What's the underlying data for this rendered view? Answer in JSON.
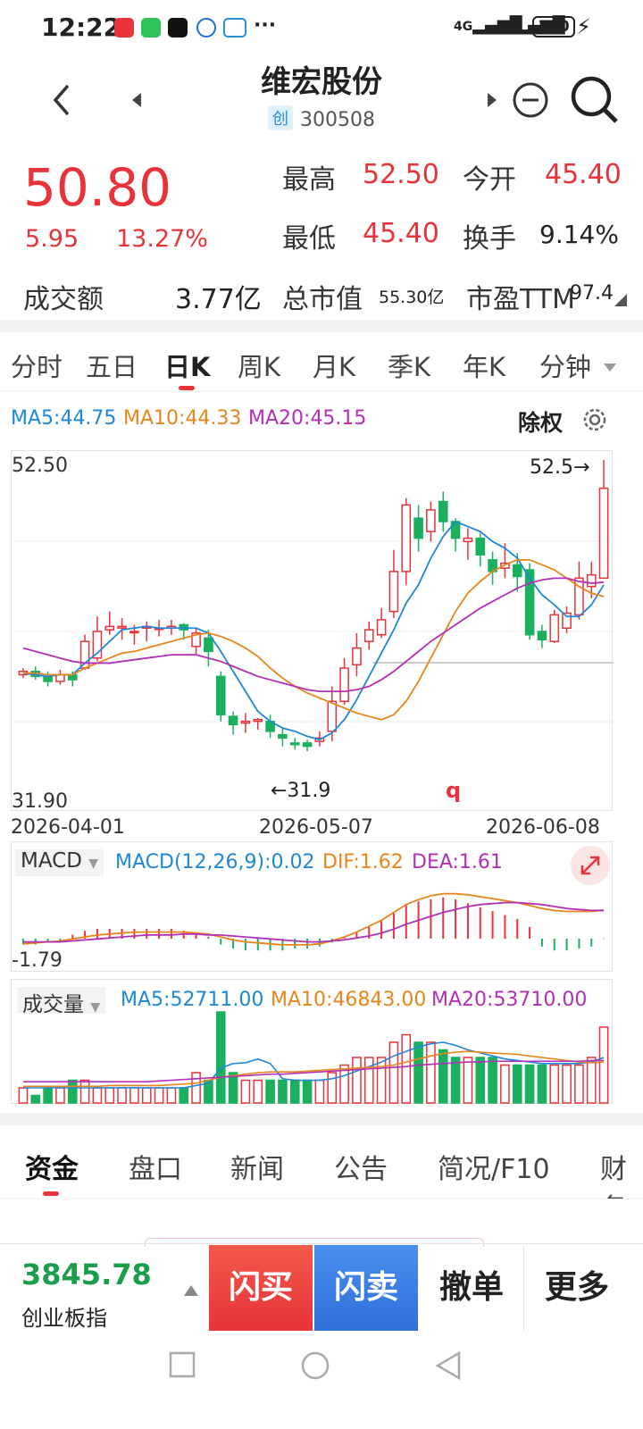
{
  "status_bar": {
    "time": "12:22",
    "network1": "4G",
    "network2": "4G",
    "battery": "100"
  },
  "header": {
    "title": "维宏股份",
    "board_badge": "创",
    "code": "300508"
  },
  "quote": {
    "price": "50.80",
    "change": "5.95",
    "change_pct": "13.27%",
    "high_label": "最高",
    "high": "52.50",
    "open_label": "今开",
    "open": "45.40",
    "low_label": "最低",
    "low": "45.40",
    "turnover_label": "换手",
    "turnover": "9.14%",
    "amount_label": "成交额",
    "amount": "3.77亿",
    "mktcap_label": "总市值",
    "mktcap": "55.30亿",
    "pe_label": "市盈TTM",
    "pe": "97.4"
  },
  "period_tabs": [
    {
      "label": "分时"
    },
    {
      "label": "五日"
    },
    {
      "label": "日K"
    },
    {
      "label": "周K"
    },
    {
      "label": "月K"
    },
    {
      "label": "季K"
    },
    {
      "label": "年K"
    },
    {
      "label": "分钟"
    }
  ],
  "active_period": "日K",
  "ma_legend": {
    "ma5": "MA5:44.75",
    "ma10": "MA10:44.33",
    "ma20": "MA20:45.15"
  },
  "adjust_label": "除权",
  "kline": {
    "y_max_label": "52.50",
    "y_min_label": "31.90",
    "high_marker": "52.5→",
    "low_marker": "←31.9",
    "stray_mark": "q",
    "dates": [
      "2026-04-01",
      "2026-05-07",
      "2026-06-08"
    ]
  },
  "macd": {
    "name": "MACD",
    "params": "MACD(12,26,9):0.02",
    "dif": "DIF:1.62",
    "dea": "DEA:1.61",
    "axis_label": "-1.79"
  },
  "volume": {
    "name": "成交量",
    "ma5": "MA5:52711.00",
    "ma10": "MA10:46843.00",
    "ma20": "MA20:53710.00"
  },
  "bottom_tabs": [
    {
      "label": "资金"
    },
    {
      "label": "盘口"
    },
    {
      "label": "新闻"
    },
    {
      "label": "公告"
    },
    {
      "label": "简况/F10"
    },
    {
      "label": "财务"
    }
  ],
  "index": {
    "value": "3845.78",
    "name": "创业板指"
  },
  "trade_buttons": {
    "flash_buy": "闪买",
    "flash_sell": "闪卖",
    "cancel": "撤单",
    "more": "更多"
  },
  "colors": {
    "up": "#e8333a",
    "down": "#1bb05e",
    "ma5": "#1e88d8",
    "ma10": "#e8851c",
    "ma20": "#b32fb6"
  },
  "chart_data": {
    "type": "candlestick",
    "title": "",
    "x_range": [
      "2026-04-01",
      "2026-06-08"
    ],
    "ylim": [
      31.9,
      52.5
    ],
    "candles": [
      [
        39.6,
        39.8,
        39.4,
        40.0
      ],
      [
        39.8,
        39.5,
        39.3,
        40.1
      ],
      [
        39.5,
        39.2,
        38.9,
        39.8
      ],
      [
        39.2,
        39.6,
        39.0,
        39.9
      ],
      [
        39.6,
        39.3,
        38.9,
        39.8
      ],
      [
        40.0,
        41.6,
        39.9,
        42.0
      ],
      [
        40.6,
        42.2,
        40.4,
        43.1
      ],
      [
        42.3,
        42.5,
        42.0,
        43.4
      ],
      [
        42.4,
        42.5,
        41.7,
        43.0
      ],
      [
        42.2,
        42.2,
        41.4,
        42.6
      ],
      [
        42.4,
        42.5,
        41.6,
        42.8
      ],
      [
        42.4,
        42.4,
        41.9,
        42.9
      ],
      [
        42.4,
        42.5,
        42.0,
        42.9
      ],
      [
        42.6,
        42.3,
        41.7,
        42.7
      ],
      [
        41.3,
        42.1,
        40.8,
        42.4
      ],
      [
        41.8,
        41.0,
        40.1,
        42.3
      ],
      [
        39.5,
        37.2,
        36.8,
        39.8
      ],
      [
        37.1,
        36.6,
        36.0,
        37.4
      ],
      [
        36.7,
        36.8,
        36.1,
        37.3
      ],
      [
        36.8,
        36.9,
        36.3,
        37.0
      ],
      [
        36.8,
        36.2,
        35.8,
        37.2
      ],
      [
        36.0,
        35.8,
        35.3,
        36.4
      ],
      [
        35.5,
        35.4,
        35.1,
        35.8
      ],
      [
        35.5,
        35.3,
        35.0,
        35.7
      ],
      [
        35.6,
        35.8,
        35.3,
        36.2
      ],
      [
        36.2,
        38.0,
        35.6,
        38.9
      ],
      [
        38.0,
        40.0,
        37.8,
        40.6
      ],
      [
        40.2,
        41.2,
        39.5,
        42.1
      ],
      [
        41.6,
        42.3,
        41.1,
        42.8
      ],
      [
        42.0,
        42.9,
        41.8,
        43.6
      ],
      [
        43.4,
        45.8,
        43.0,
        47.1
      ],
      [
        45.8,
        49.8,
        45.0,
        50.2
      ],
      [
        49.0,
        47.8,
        47.0,
        49.8
      ],
      [
        48.2,
        49.5,
        47.6,
        50.0
      ],
      [
        50.0,
        48.8,
        48.2,
        50.6
      ],
      [
        48.8,
        47.8,
        47.0,
        49.0
      ],
      [
        47.6,
        47.8,
        46.5,
        48.4
      ],
      [
        47.8,
        46.8,
        46.1,
        48.1
      ],
      [
        46.5,
        45.8,
        45.0,
        47.0
      ],
      [
        46.0,
        46.3,
        45.4,
        47.5
      ],
      [
        46.2,
        45.5,
        44.6,
        46.9
      ],
      [
        45.9,
        42.0,
        41.7,
        46.3
      ],
      [
        42.2,
        41.7,
        41.2,
        42.6
      ],
      [
        41.6,
        43.2,
        41.5,
        43.5
      ],
      [
        42.4,
        43.3,
        42.1,
        43.7
      ],
      [
        43.2,
        45.4,
        42.9,
        46.4
      ],
      [
        44.9,
        45.6,
        44.2,
        46.4
      ],
      [
        45.4,
        50.8,
        45.4,
        52.5
      ]
    ],
    "ma5": [
      39.7,
      39.6,
      39.5,
      39.6,
      39.6,
      40.3,
      40.9,
      41.6,
      42.3,
      42.4,
      42.5,
      42.4,
      42.4,
      42.4,
      42.4,
      42.1,
      41.0,
      39.8,
      38.6,
      37.4,
      36.8,
      36.4,
      36.2,
      35.9,
      35.7,
      36.1,
      36.9,
      38.1,
      39.5,
      40.9,
      42.3,
      43.9,
      45.0,
      46.6,
      47.9,
      48.8,
      48.5,
      48.2,
      47.6,
      47.2,
      46.6,
      45.4,
      44.4,
      43.8,
      43.1,
      43.1,
      43.8,
      45.0
    ],
    "ma10": [
      39.7,
      39.7,
      39.6,
      39.6,
      39.6,
      40.0,
      40.3,
      40.6,
      40.9,
      41.0,
      41.2,
      41.4,
      41.6,
      41.8,
      42.0,
      42.1,
      41.9,
      41.6,
      41.2,
      40.7,
      40.0,
      39.4,
      38.9,
      38.5,
      38.2,
      37.9,
      37.6,
      37.3,
      37.1,
      36.9,
      37.2,
      38.0,
      39.2,
      40.6,
      42.0,
      43.4,
      44.5,
      45.2,
      45.8,
      46.2,
      46.5,
      46.5,
      46.2,
      45.9,
      45.4,
      44.9,
      44.5,
      44.3
    ],
    "ma20": [
      41.2,
      41.0,
      40.8,
      40.6,
      40.4,
      40.3,
      40.3,
      40.3,
      40.4,
      40.5,
      40.6,
      40.7,
      40.8,
      40.8,
      40.8,
      40.6,
      40.4,
      40.1,
      39.8,
      39.5,
      39.3,
      39.1,
      38.9,
      38.7,
      38.6,
      38.6,
      38.6,
      38.7,
      38.9,
      39.3,
      39.8,
      40.4,
      41.0,
      41.6,
      42.1,
      42.6,
      43.1,
      43.6,
      44.0,
      44.4,
      44.8,
      45.1,
      45.3,
      45.4,
      45.4,
      45.2,
      45.1,
      45.15
    ],
    "macd_hist": [
      -0.3,
      -0.3,
      -0.2,
      -0.1,
      0.2,
      0.4,
      0.5,
      0.5,
      0.5,
      0.5,
      0.5,
      0.5,
      0.5,
      0.4,
      0.3,
      0.1,
      -0.3,
      -0.5,
      -0.6,
      -0.6,
      -0.6,
      -0.6,
      -0.5,
      -0.5,
      -0.4,
      -0.2,
      0.1,
      0.3,
      0.6,
      0.9,
      1.3,
      1.7,
      1.9,
      2.0,
      2.1,
      2.0,
      1.8,
      1.6,
      1.4,
      1.2,
      1.0,
      0.6,
      -0.4,
      -0.6,
      -0.6,
      -0.5,
      -0.4,
      0.02
    ],
    "dif": [
      -1.8,
      -1.7,
      -1.6,
      -1.5,
      -1.3,
      -1.1,
      -0.9,
      -0.8,
      -0.7,
      -0.6,
      -0.6,
      -0.6,
      -0.6,
      -0.6,
      -0.7,
      -0.8,
      -1.1,
      -1.4,
      -1.6,
      -1.7,
      -1.8,
      -1.9,
      -1.9,
      -1.9,
      -1.8,
      -1.5,
      -1.1,
      -0.6,
      0.0,
      0.6,
      1.4,
      2.2,
      2.7,
      3.1,
      3.3,
      3.3,
      3.2,
      3.0,
      2.8,
      2.6,
      2.4,
      2.1,
      1.8,
      1.6,
      1.5,
      1.5,
      1.5,
      1.62
    ],
    "dea": [
      -1.6,
      -1.6,
      -1.6,
      -1.6,
      -1.5,
      -1.4,
      -1.3,
      -1.2,
      -1.1,
      -1.0,
      -0.9,
      -0.9,
      -0.9,
      -0.8,
      -0.8,
      -0.9,
      -0.9,
      -1.0,
      -1.1,
      -1.2,
      -1.3,
      -1.4,
      -1.5,
      -1.6,
      -1.6,
      -1.5,
      -1.4,
      -1.2,
      -1.0,
      -0.7,
      -0.3,
      0.2,
      0.6,
      1.0,
      1.4,
      1.7,
      2.0,
      2.2,
      2.3,
      2.4,
      2.4,
      2.3,
      2.2,
      2.0,
      1.8,
      1.7,
      1.6,
      1.61
    ],
    "volume": [
      2,
      1,
      2,
      2,
      3,
      3,
      2,
      2,
      2,
      2,
      2,
      2,
      2,
      2,
      4,
      3,
      12,
      4,
      3,
      3,
      3,
      3,
      3,
      3,
      3,
      4,
      5,
      6,
      6,
      6,
      8,
      9,
      8,
      8,
      7,
      6,
      6,
      6,
      6,
      5,
      5,
      5,
      5,
      5,
      5,
      5,
      6,
      10
    ],
    "vol_ma5": [
      2,
      2,
      2,
      2,
      2,
      2,
      2,
      2,
      2,
      2,
      2,
      2,
      2,
      2,
      2.3,
      2.6,
      4.6,
      5.2,
      5.3,
      5.8,
      5.2,
      3.2,
      3.0,
      3.0,
      3.0,
      3.2,
      3.6,
      4.2,
      4.8,
      5.4,
      6.2,
      6.8,
      7.4,
      7.8,
      8.0,
      7.6,
      7.0,
      6.6,
      6.2,
      5.8,
      5.6,
      5.4,
      5.2,
      5.2,
      5.2,
      5.2,
      5.4,
      6.0
    ],
    "vol_ma10": [
      2.2,
      2.2,
      2.2,
      2.2,
      2.2,
      2.2,
      2.2,
      2.3,
      2.3,
      2.3,
      2.3,
      2.3,
      2.4,
      2.5,
      2.6,
      3.0,
      3.4,
      3.6,
      3.8,
      4.0,
      4.1,
      4.1,
      4.1,
      4.2,
      4.3,
      4.4,
      4.5,
      4.6,
      4.7,
      4.8,
      5.0,
      5.4,
      5.8,
      6.2,
      6.5,
      6.7,
      6.8,
      6.7,
      6.6,
      6.5,
      6.4,
      6.2,
      6.0,
      5.8,
      5.6,
      5.4,
      5.3,
      5.4
    ],
    "vol_ma20": [
      2.8,
      2.8,
      2.8,
      2.8,
      2.8,
      2.8,
      2.8,
      2.8,
      2.8,
      2.8,
      2.8,
      2.9,
      3.0,
      3.1,
      3.2,
      3.3,
      3.4,
      3.5,
      3.6,
      3.7,
      3.8,
      3.8,
      3.9,
      4.0,
      4.1,
      4.2,
      4.3,
      4.4,
      4.5,
      4.6,
      4.7,
      4.8,
      5.0,
      5.1,
      5.2,
      5.3,
      5.4,
      5.4,
      5.5,
      5.5,
      5.5,
      5.5,
      5.5,
      5.5,
      5.5,
      5.5,
      5.6,
      5.6
    ]
  }
}
